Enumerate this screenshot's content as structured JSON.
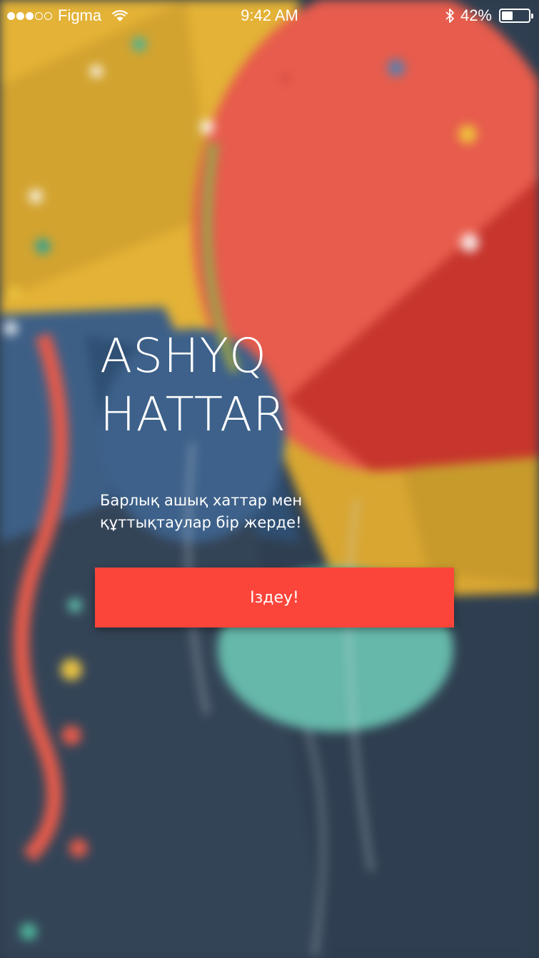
{
  "status_bar": {
    "carrier": "Figma",
    "time": "9:42 AM",
    "battery_percent_text": "42%",
    "battery_level": 0.42,
    "signal_bars_filled": 3,
    "signal_bars_total": 5
  },
  "hero": {
    "title_line1": "ASHYQ",
    "title_line2": "HATTAR",
    "subtitle_line1": "Барлық ашық хаттар мен",
    "subtitle_line2": "құттықтаулар бір жерде!",
    "button_label": "Іздеу!"
  },
  "colors": {
    "accent_button": "#fb453a",
    "balloon_red": "#e8584a",
    "balloon_yellow": "#e8b83a",
    "balloon_teal": "#5fb7a8",
    "balloon_blue": "#3f6187",
    "background_dark": "#2c3a4a",
    "text": "#ffffff"
  },
  "background_icon": "party-balloons-illustration"
}
